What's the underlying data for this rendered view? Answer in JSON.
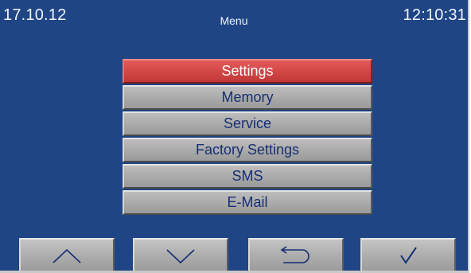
{
  "status_bar": {
    "date": "17.10.12",
    "title": "Menu",
    "time": "12:10:31"
  },
  "menu": {
    "selected_index": 0,
    "items": [
      {
        "label": "Settings"
      },
      {
        "label": "Memory"
      },
      {
        "label": "Service"
      },
      {
        "label": "Factory Settings"
      },
      {
        "label": "SMS"
      },
      {
        "label": "E-Mail"
      }
    ]
  },
  "nav_buttons": [
    {
      "icon": "chevron-up-icon"
    },
    {
      "icon": "chevron-down-icon"
    },
    {
      "icon": "return-arrow-icon"
    },
    {
      "icon": "checkmark-icon"
    }
  ],
  "colors": {
    "screen_background": "#1f4585",
    "selected_item": "#d24545",
    "item": "#a9a9a9",
    "item_text": "#152f73",
    "status_text": "#f2f5fb"
  }
}
